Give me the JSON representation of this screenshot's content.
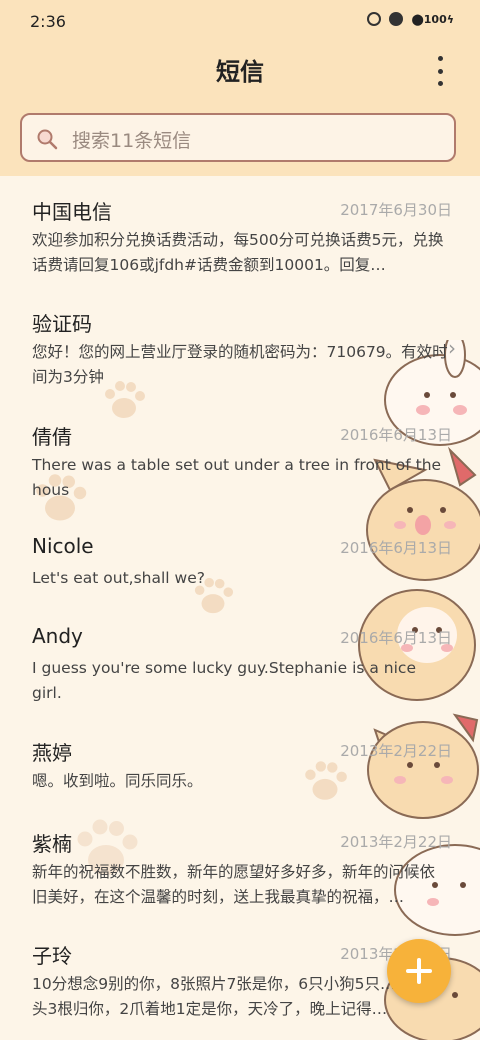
{
  "status": {
    "time": "2:36",
    "battery": "100"
  },
  "header": {
    "title": "短信"
  },
  "search": {
    "placeholder": "搜索11条短信"
  },
  "messages": [
    {
      "name": "中国电信",
      "date": "2017年6月30日",
      "preview": "欢迎参加积分兑换话费活动，每500分可兑换话费5元，兑换话费请回复106或jfdh#话费金额到10001。回复…"
    },
    {
      "name": "验证码",
      "date": "",
      "preview": "您好！您的网上营业厅登录的随机密码为：710679。有效时间为3分钟"
    },
    {
      "name": "倩倩",
      "date": "2016年6月13日",
      "preview": "There was a table set out under a tree in front of the hous"
    },
    {
      "name": "Nicole",
      "date": "2016年6月13日",
      "preview": "Let's eat out,shall we?"
    },
    {
      "name": "Andy",
      "date": "2016年6月13日",
      "preview": "I guess you're some lucky guy.Stephanie is a nice girl."
    },
    {
      "name": "燕婷",
      "date": "2013年2月22日",
      "preview": "嗯。收到啦。同乐同乐。"
    },
    {
      "name": "紫楠",
      "date": "2013年2月22日",
      "preview": "新年的祝福数不胜数，新年的愿望好多好多，新年的问候依旧美好，在这个温馨的时刻，送上我最真挚的祝福，…"
    },
    {
      "name": "子玲",
      "date": "2013年2月22日",
      "preview": "10分想念9别的你，8张照片7张是你，6只小狗5只…4根骨头3根归你，2爪着地1定是你，天冷了，晚上记得…"
    }
  ],
  "colors": {
    "header_bg": "#fbe3bc",
    "page_bg": "#fdf5e8",
    "fab": "#f7b23a",
    "search_border": "#b07a6c"
  }
}
